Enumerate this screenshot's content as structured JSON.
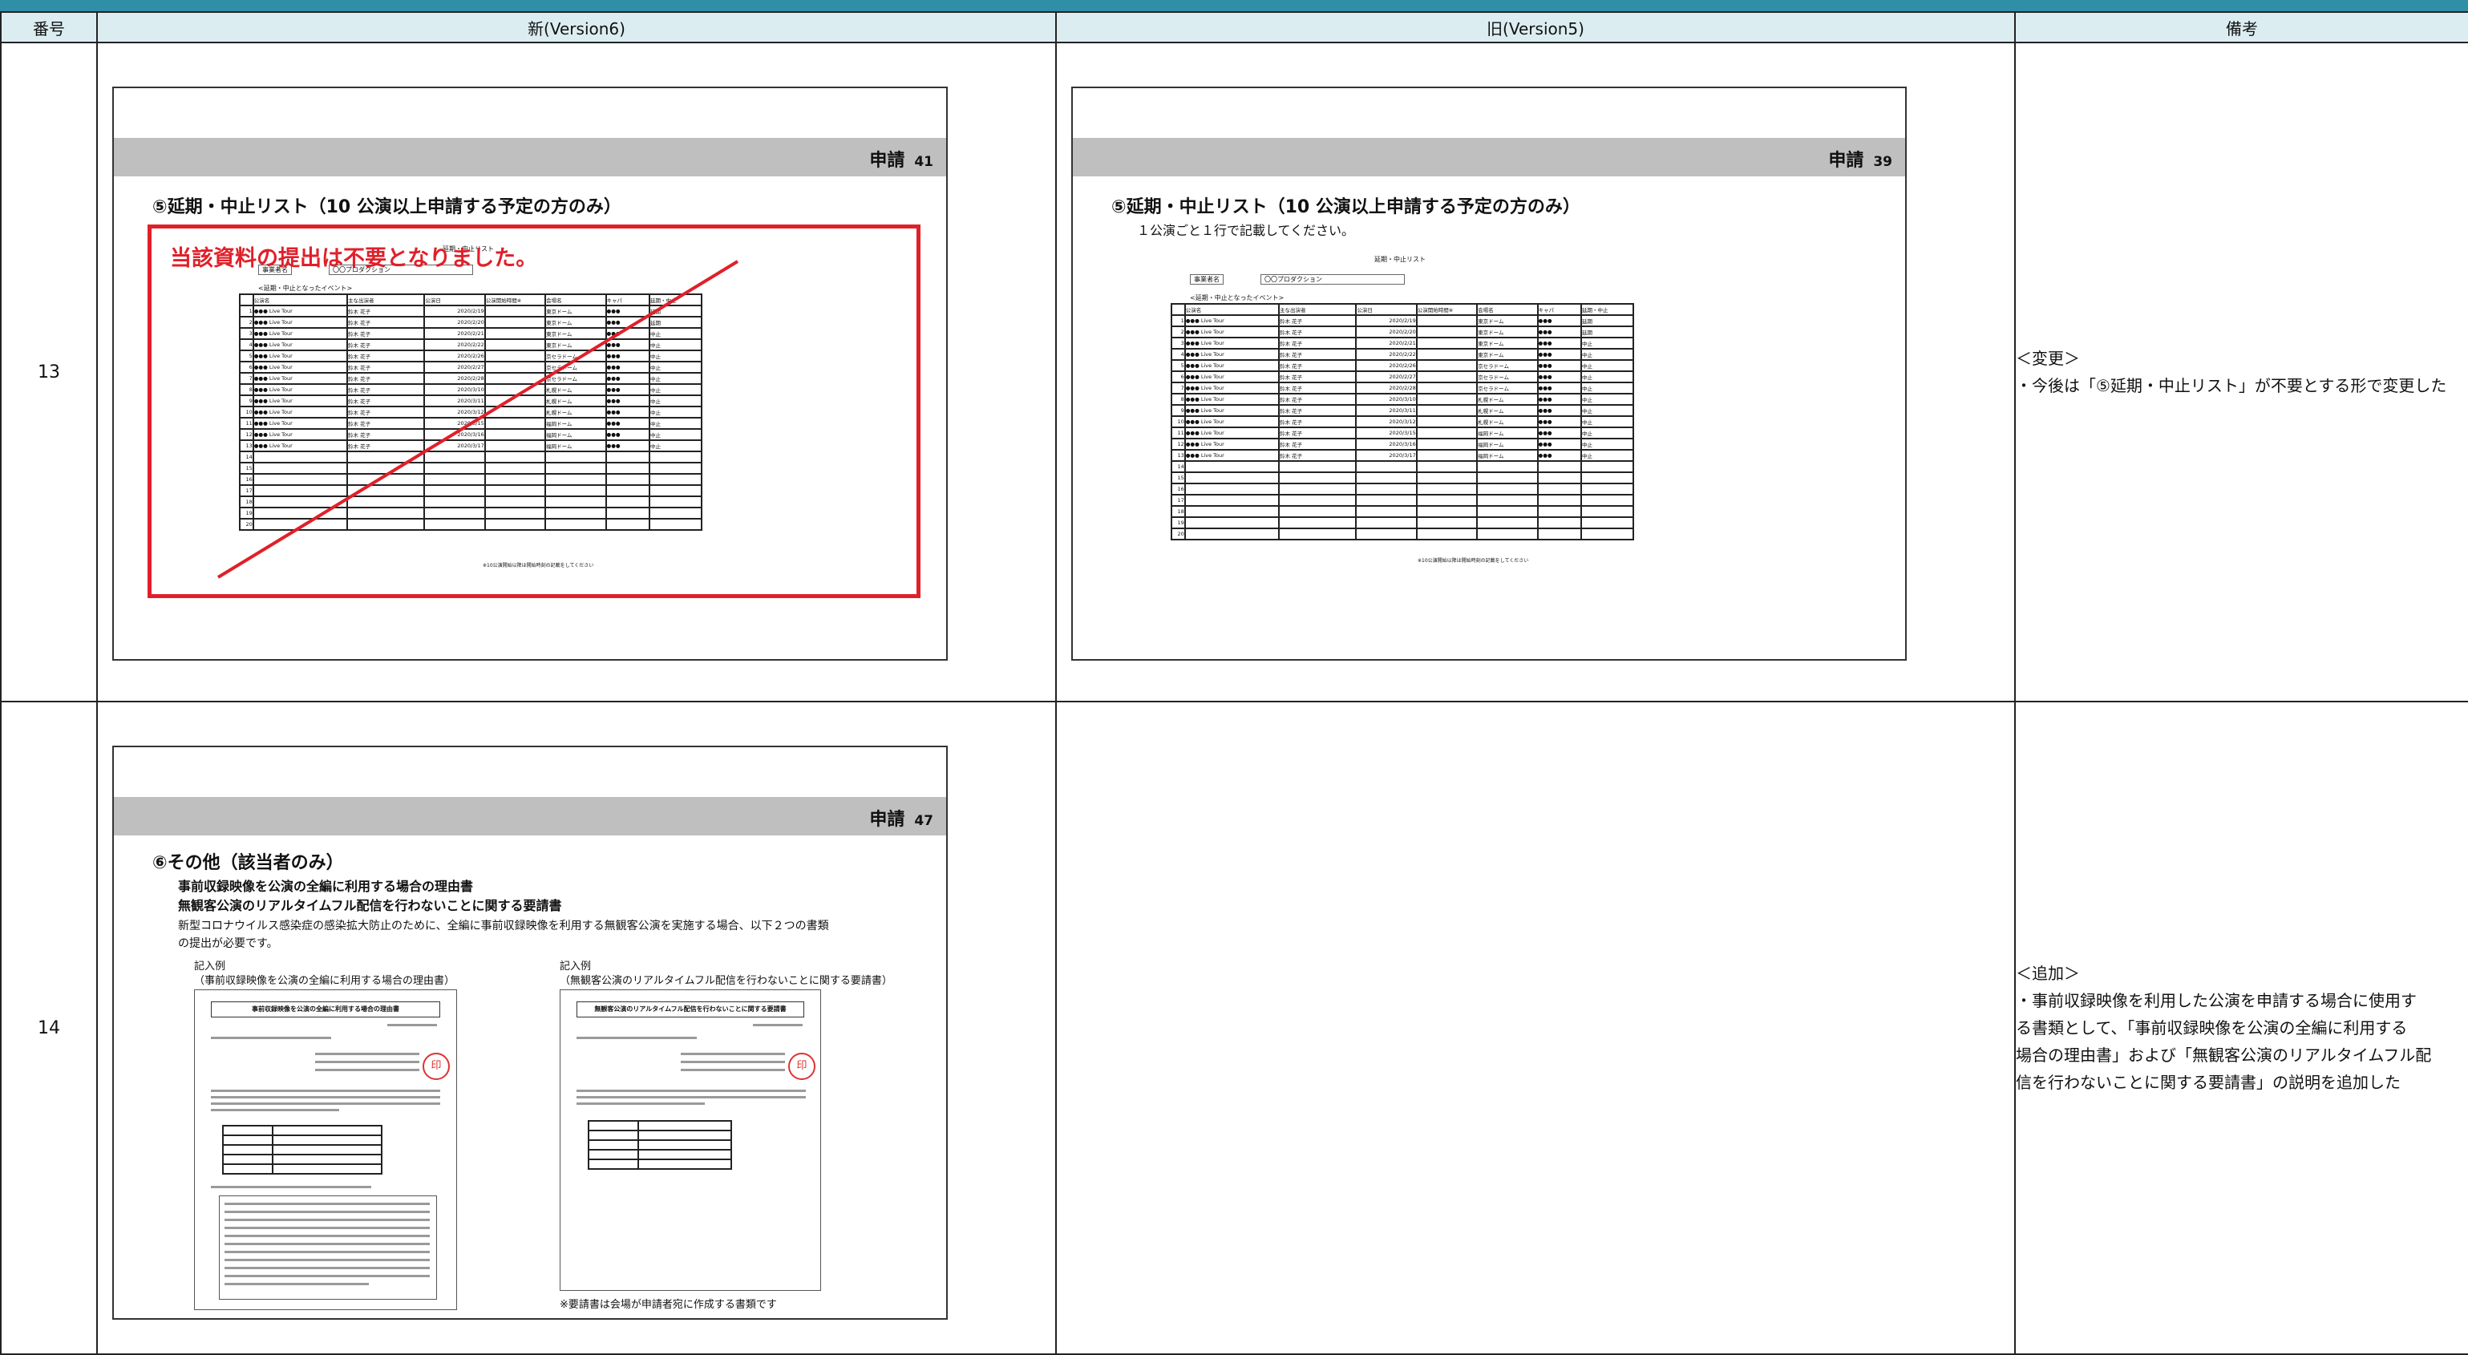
{
  "headers": {
    "num": "番号",
    "new": "新(Version6)",
    "old": "旧(Version5)",
    "note": "備考"
  },
  "rows": [
    {
      "num": "13",
      "new_slide": {
        "section": "申請",
        "page": "41",
        "title": "⑤延期・中止リスト（10 公演以上申請する予定の方のみ）",
        "overlay": "当該資料の提出は不要となりました。"
      },
      "old_slide": {
        "section": "申請",
        "page": "39",
        "title": "⑤延期・中止リスト（10 公演以上申請する予定の方のみ）",
        "subtitle": "１公演ごと１行で記載してください。"
      },
      "note_heading": "＜変更＞",
      "note_body": "・今後は「⑤延期・中止リスト」が不要とする形で変更した"
    },
    {
      "num": "14",
      "new_slide": {
        "section": "申請",
        "page": "47",
        "title": "⑥その他（該当者のみ）",
        "bold_lines": [
          "事前収録映像を公演の全編に利用する場合の理由書",
          "無観客公演のリアルタイムフル配信を行わないことに関する要請書"
        ],
        "body_lines": [
          "新型コロナウイルス感染症の感染拡大防止のために、全編に事前収録映像を利用する無観客公演を実施する場合、以下２つの書類",
          "の提出が必要です。"
        ],
        "example1_label": "記入例",
        "example1_caption": "（事前収録映像を公演の全編に利用する場合の理由書）",
        "example2_label": "記入例",
        "example2_caption": "（無観客公演のリアルタイムフル配信を行わないことに関する要請書）",
        "footnote": "※要請書は会場が申請者宛に作成する書類です"
      },
      "note_heading": "＜追加＞",
      "note_lines": [
        "・事前収録映像を利用した公演を申請する場合に使用す",
        "る書類として、「事前収録映像を公演の全編に利用する",
        "場合の理由書」および「無観客公演のリアルタイムフル配",
        "信を行わないことに関する要請書」の説明を追加した"
      ]
    }
  ],
  "mini_list": {
    "title": "延期・中止リスト",
    "company_label": "事業者名",
    "company_value": "〇〇プロダクション",
    "section_label": "<延期・中止となったイベント>",
    "columns": [
      "公演名",
      "主な出演者",
      "公演日",
      "公演開始時間※",
      "会場名",
      "キャパ",
      "延期・中止"
    ],
    "rows": [
      [
        "●●● Live Tour",
        "鈴木 花子",
        "2020/2/19",
        "",
        "東京ドーム",
        "●●●",
        "延期"
      ],
      [
        "●●● Live Tour",
        "鈴木 花子",
        "2020/2/20",
        "",
        "東京ドーム",
        "●●●",
        "延期"
      ],
      [
        "●●● Live Tour",
        "鈴木 花子",
        "2020/2/21",
        "",
        "東京ドーム",
        "●●●",
        "中止"
      ],
      [
        "●●● Live Tour",
        "鈴木 花子",
        "2020/2/22",
        "",
        "東京ドーム",
        "●●●",
        "中止"
      ],
      [
        "●●● Live Tour",
        "鈴木 花子",
        "2020/2/26",
        "",
        "京セラドーム",
        "●●●",
        "中止"
      ],
      [
        "●●● Live Tour",
        "鈴木 花子",
        "2020/2/27",
        "",
        "京セラドーム",
        "●●●",
        "中止"
      ],
      [
        "●●● Live Tour",
        "鈴木 花子",
        "2020/2/28",
        "",
        "京セラドーム",
        "●●●",
        "中止"
      ],
      [
        "●●● Live Tour",
        "鈴木 花子",
        "2020/3/10",
        "",
        "札幌ドーム",
        "●●●",
        "中止"
      ],
      [
        "●●● Live Tour",
        "鈴木 花子",
        "2020/3/11",
        "",
        "札幌ドーム",
        "●●●",
        "中止"
      ],
      [
        "●●● Live Tour",
        "鈴木 花子",
        "2020/3/12",
        "",
        "札幌ドーム",
        "●●●",
        "中止"
      ],
      [
        "●●● Live Tour",
        "鈴木 花子",
        "2020/3/15",
        "",
        "福岡ドーム",
        "●●●",
        "中止"
      ],
      [
        "●●● Live Tour",
        "鈴木 花子",
        "2020/3/16",
        "",
        "福岡ドーム",
        "●●●",
        "中止"
      ],
      [
        "●●● Live Tour",
        "鈴木 花子",
        "2020/3/17",
        "",
        "福岡ドーム",
        "●●●",
        "中止"
      ]
    ],
    "row_numbers": [
      "1",
      "2",
      "3",
      "4",
      "5",
      "6",
      "7",
      "8",
      "9",
      "10",
      "11",
      "12",
      "13",
      "14",
      "15",
      "16",
      "17",
      "18",
      "19",
      "20"
    ],
    "footnote": "※10公演開始以降は開始時刻の記載をしてください"
  },
  "doc1": {
    "title": "事前収録映像を公演の全編に利用する場合の理由書",
    "seal": "印"
  },
  "doc2": {
    "title": "無観客公演のリアルタイムフル配信を行わないことに関する要請書",
    "seal": "印"
  }
}
